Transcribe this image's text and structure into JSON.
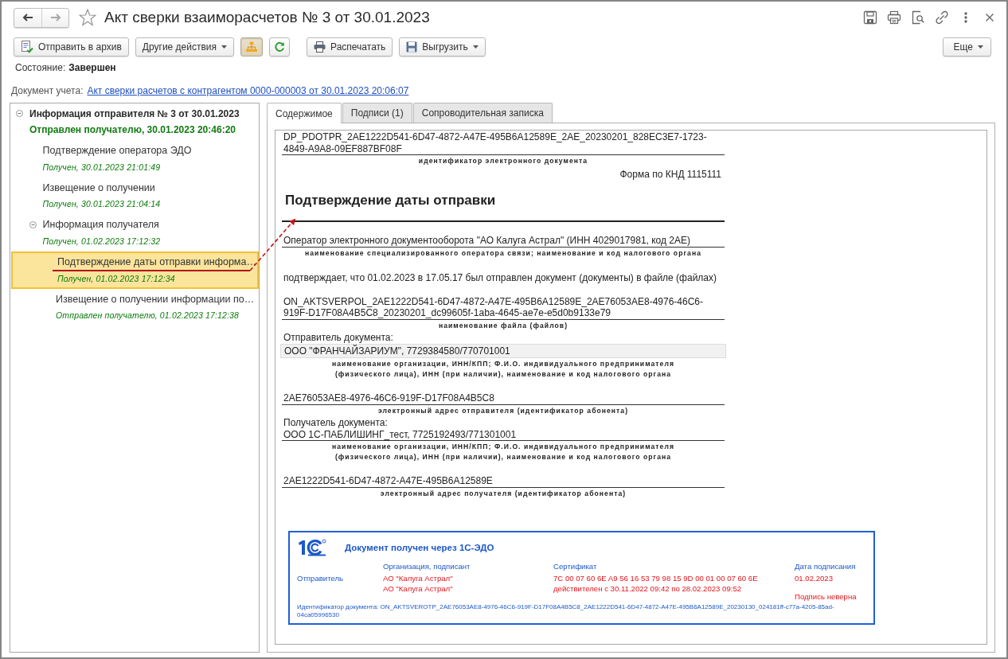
{
  "window": {
    "title": "Акт сверки взаиморасчетов № 3 от 30.01.2023",
    "favorite": false
  },
  "nav": [
    {
      "kind": "back",
      "disabled": false
    },
    {
      "kind": "forward",
      "disabled": true
    }
  ],
  "toolbar": {
    "archive_button": "Отправить в архив",
    "actions_menu": "Другие действия",
    "structure_toggle": {
      "on": true
    },
    "print_button": "Распечатать",
    "export_menu": "Выгрузить",
    "more_menu": "Еще"
  },
  "state": {
    "label": "Состояние:",
    "value": "Завершен"
  },
  "accounting_document": {
    "label": "Документ учета:",
    "link": "Акт сверки расчетов с контрагентом 0000-000003 от 30.01.2023 20:06:07"
  },
  "tree": [
    {
      "title": "Информация отправителя № 3 от 30.01.2023",
      "status": "Отправлен получателю, 30.01.2023 20:46:20",
      "expanded": true,
      "selected": false,
      "children": [
        {
          "title": "Подтверждение оператора ЭДО",
          "status": "Получен, 30.01.2023 21:01:49",
          "selected": false
        },
        {
          "title": "Извещение о получении",
          "status": "Получен, 30.01.2023 21:04:14",
          "selected": false
        },
        {
          "title": "Информация получателя",
          "status": "Получен, 01.02.2023 17:12:32",
          "expanded": true,
          "selected": false,
          "children": [
            {
              "title": "Подтверждение даты отправки информа…",
              "status": "Получен, 01.02.2023 17:12:34",
              "selected": true
            },
            {
              "title": "Извещение о получении информации по…",
              "status": "Отправлен получателю, 01.02.2023 17:12:38",
              "selected": false
            }
          ]
        }
      ]
    }
  ],
  "tabs": [
    {
      "label": "Содержимое",
      "selected": true
    },
    {
      "label": "Подписи (1)",
      "selected": false
    },
    {
      "label": "Сопроводительная записка",
      "selected": false
    }
  ],
  "document": {
    "blocks": [
      {
        "kind": "field",
        "value": "DP_PDOTPR_2AE1222D541-6D47-4872-A47E-495B6A12589E_2AE_20230201_828EC3E7-1723-4849-A9A8-09EF887BF08F",
        "caption": "идентификатор электронного документа",
        "selected": false
      },
      {
        "kind": "form_code",
        "text": "Форма по КНД 1115111"
      },
      {
        "kind": "heading",
        "text": "Подтверждение даты отправки"
      },
      {
        "kind": "field",
        "value": "Оператор электронного документооборота \"АО Калуга Астрал\" (ИНН 4029017981, код 2АЕ)",
        "caption": "наименование специализированного оператора связи; наименование и код налогового органа",
        "selected": false
      },
      {
        "kind": "sentence",
        "text": "подтверждает, что 01.02.2023 в 17.05.17 был отправлен документ (документы) в файле (файлах)"
      },
      {
        "kind": "field",
        "value": "ON_AKTSVERPOL_2AE1222D541-6D47-4872-A47E-495B6A12589E_2AE76053AE8-4976-46C6-919F-D17F08A4B5C8_20230201_dc99605f-1aba-4645-ae7e-e5d0b9133e79",
        "caption": "наименование файла (файлов)",
        "selected": false
      },
      {
        "kind": "label",
        "text": "Отправитель документа:"
      },
      {
        "kind": "field",
        "value": "ООО \"ФРАНЧАЙЗАРИУМ\", 7729384580/770701001",
        "caption": "наименование организации, ИНН/КПП; Ф.И.О. индивидуального предпринимателя\n(физического лица), ИНН (при наличии), наименование и код налогового органа",
        "selected": true
      },
      {
        "kind": "field",
        "value": "2AE76053AE8-4976-46C6-919F-D17F08A4B5C8",
        "caption": "электронный адрес отправителя (идентификатор абонента)",
        "selected": false
      },
      {
        "kind": "label",
        "text": "Получатель документа:"
      },
      {
        "kind": "field",
        "value": "ООО 1С-ПАБЛИШИНГ_тест, 7725192493/771301001",
        "caption": "наименование организации, ИНН/КПП; Ф.И.О. индивидуального предпринимателя\n(физического лица), ИНН (при наличии), наименование и код налогового органа",
        "selected": false
      },
      {
        "kind": "field",
        "value": "2AE1222D541-6D47-4872-A47E-495B6A12589E",
        "caption": "электронный адрес получателя (идентификатор абонента)",
        "selected": false
      }
    ]
  },
  "stamp": {
    "title": "Документ получен через 1С-ЭДО",
    "columns": [
      "Организация, подписант",
      "Сертификат",
      "Дата подписания"
    ],
    "signers": [
      {
        "role": "Отправитель",
        "organization": "АО \"Калуга Астрал\"",
        "signer": "АО \"Калуга Астрал\"",
        "certificate": "7C 00 07 60 6E A9 56 16 53 79 98 15 9D 00 01 00 07 60 6E",
        "validity": "действителен с 30.11.2022 09:42 по 28.02.2023 09:52",
        "date": "01.02.2023",
        "signature_status": "Подпись неверна",
        "signature_valid": false
      }
    ],
    "document_id": "Идентификатор документа: ON_AKTSVEROTP_2AE76053AE8-4976-46C6-919F-D17F08A4B5C8_2AE1222D541-6D47-4872-A47E-495B6A12589E_20230130_024181ff-c77a-4205-85ad-04ca05996530"
  }
}
